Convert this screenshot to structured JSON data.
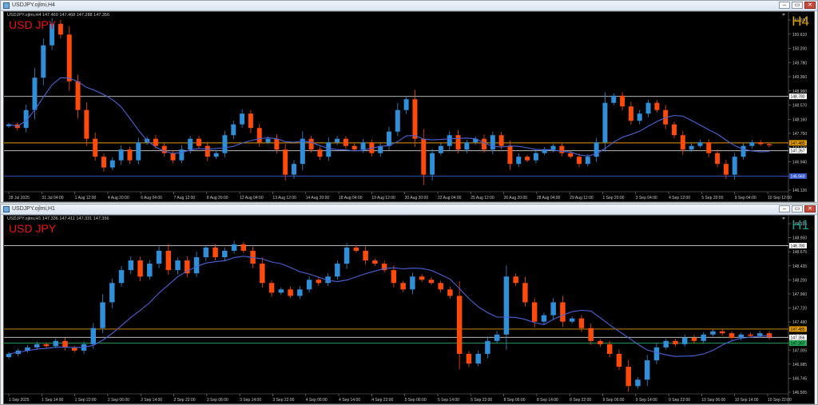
{
  "colors": {
    "bull": "#2f8fd8",
    "bear": "#ff4a0a",
    "ma": "#4a62d6",
    "grid": "#222222",
    "axis_text": "#c8c8c8",
    "tf_h4": "#e0a000",
    "tf_h1": "#1a9a8c",
    "symbol": "#ee1111"
  },
  "windows": [
    {
      "title": "USDJPY.ojlmi,H4",
      "info_line": "USDJPY.ojlmi,H4  147.460 147.468 147.288 147.356",
      "symbol_label": "USD JPY",
      "timeframe_label": "H4",
      "buttons": {
        "minimize": "–",
        "maximize": "▭",
        "close": "✕"
      },
      "chart_data": {
        "type": "candlestick",
        "symbol": "USDJPY",
        "timeframe": "H4",
        "ylim": [
          146.126,
          151.04
        ],
        "y_ticks": [
          "151.030",
          "150.610",
          "150.200",
          "149.780",
          "149.360",
          "148.960",
          "148.570",
          "148.160",
          "147.750",
          "147.340",
          "146.940",
          "146.530",
          "146.126"
        ],
        "x_ticks": [
          "28 Jul 2025",
          "31 Jul 04:00",
          "1 Aug 12:00",
          "4 Aug 20:00",
          "6 Aug 04:00",
          "7 Aug 12:00",
          "8 Aug 20:00",
          "12 Aug 04:00",
          "13 Aug 12:00",
          "14 Aug 20:00",
          "18 Aug 04:00",
          "19 Aug 12:00",
          "20 Aug 20:00",
          "22 Aug 04:00",
          "25 Aug 12:00",
          "26 Aug 20:00",
          "28 Aug 04:00",
          "29 Aug 12:00",
          "1 Sep 20:00",
          "3 Sep 04:00",
          "4 Sep 12:00",
          "5 Sep 20:00",
          "9 Sep 04:00",
          "10 Sep 12:00"
        ],
        "levels": [
          {
            "value": 148.78,
            "label": "148.780",
            "color": "#cfcfcf",
            "box": "#ffffff",
            "text": "#000000"
          },
          {
            "value": 147.485,
            "label": "147.485",
            "color": "#e09a00",
            "box": "#e09a00",
            "text": "#000000"
          },
          {
            "value": 147.267,
            "label": "147.267",
            "color": "#d6d6d6",
            "box": "#ffffff",
            "text": "#000000"
          },
          {
            "value": 146.56,
            "label": "146.560",
            "color": "#3355cc",
            "box": "#3355cc",
            "text": "#ffffff"
          }
        ],
        "close_path": [
          148.0,
          147.9,
          148.4,
          149.3,
          150.2,
          150.8,
          150.5,
          149.2,
          148.4,
          147.6,
          147.1,
          146.8,
          147.0,
          147.3,
          147.0,
          147.5,
          147.6,
          147.4,
          147.2,
          147.0,
          147.3,
          147.6,
          147.4,
          147.1,
          147.2,
          147.7,
          148.0,
          148.3,
          147.9,
          147.5,
          147.6,
          147.3,
          146.6,
          146.9,
          147.6,
          147.3,
          147.1,
          147.5,
          147.6,
          147.4,
          147.3,
          147.5,
          147.2,
          147.4,
          147.8,
          148.4,
          148.7,
          147.6,
          146.6,
          147.2,
          147.4,
          147.7,
          147.3,
          147.5,
          147.6,
          147.3,
          147.7,
          147.4,
          146.9,
          147.1,
          147.0,
          147.2,
          147.3,
          147.4,
          147.2,
          147.1,
          146.9,
          147.1,
          147.5,
          148.6,
          148.8,
          148.5,
          148.1,
          148.3,
          148.6,
          148.4,
          148.0,
          147.7,
          147.3,
          147.4,
          147.5,
          147.2,
          146.9,
          146.6,
          147.1,
          147.4,
          147.5,
          147.45,
          147.42
        ]
      }
    },
    {
      "title": "USDJPY.ojlmi,H1",
      "info_line": "USDJPY.ojlmi,H1  147.336 147.411 147.331 147.356",
      "symbol_label": "USD JPY",
      "timeframe_label": "H1",
      "buttons": {
        "minimize": "–",
        "maximize": "▭",
        "close": "✕"
      },
      "chart_data": {
        "type": "candlestick",
        "symbol": "USDJPY",
        "timeframe": "H1",
        "ylim": [
          146.48,
          149.195
        ],
        "y_ticks": [
          "149.195",
          "148.950",
          "148.675",
          "148.435",
          "148.200",
          "147.960",
          "147.720",
          "147.480",
          "147.240",
          "147.005",
          "146.985",
          "146.745",
          "146.505"
        ],
        "x_ticks": [
          "1 Sep 2025",
          "1 Sep 14:00",
          "1 Sep 22:00",
          "2 Sep 06:00",
          "2 Sep 14:00",
          "2 Sep 22:00",
          "3 Sep 06:00",
          "3 Sep 14:00",
          "3 Sep 22:00",
          "4 Sep 06:00",
          "4 Sep 14:00",
          "4 Sep 22:00",
          "5 Sep 06:00",
          "5 Sep 14:00",
          "5 Sep 22:00",
          "8 Sep 06:00",
          "8 Sep 14:00",
          "8 Sep 22:00",
          "9 Sep 06:00",
          "9 Sep 14:00",
          "9 Sep 22:00",
          "10 Sep 06:00",
          "10 Sep 14:00",
          "10 Sep 22:00"
        ],
        "levels": [
          {
            "value": 148.78,
            "label": "148.780",
            "color": "#cfcfcf",
            "box": "#ffffff",
            "text": "#000000"
          },
          {
            "value": 147.485,
            "label": "147.485",
            "color": "#e09a00",
            "box": "#e09a00",
            "text": "#000000"
          },
          {
            "value": 147.356,
            "label": "147.356",
            "color": "#d6d6d6",
            "box": "#ffffff",
            "text": "#000000"
          },
          {
            "value": 147.267,
            "label": "147.267",
            "color": "#22aa55",
            "box": "#22aa55",
            "text": "#000000"
          }
        ],
        "close_path": [
          147.1,
          147.15,
          147.2,
          147.25,
          147.22,
          147.3,
          147.2,
          147.15,
          147.25,
          147.5,
          147.9,
          148.2,
          148.4,
          148.55,
          148.3,
          148.5,
          148.7,
          148.4,
          148.55,
          148.35,
          148.6,
          148.75,
          148.6,
          148.7,
          148.8,
          148.7,
          148.5,
          148.2,
          148.05,
          148.1,
          148.0,
          148.1,
          148.25,
          148.2,
          148.3,
          148.5,
          148.75,
          148.7,
          148.55,
          148.5,
          148.4,
          148.2,
          148.1,
          148.3,
          148.25,
          148.2,
          148.1,
          148.0,
          147.1,
          146.95,
          147.1,
          147.3,
          147.4,
          148.3,
          148.2,
          147.9,
          147.6,
          147.7,
          147.9,
          147.6,
          147.65,
          147.5,
          147.3,
          147.25,
          147.1,
          146.9,
          146.6,
          146.7,
          147.0,
          147.2,
          147.3,
          147.25,
          147.35,
          147.3,
          147.4,
          147.45,
          147.42,
          147.35,
          147.4,
          147.38,
          147.42,
          147.36
        ]
      }
    }
  ]
}
